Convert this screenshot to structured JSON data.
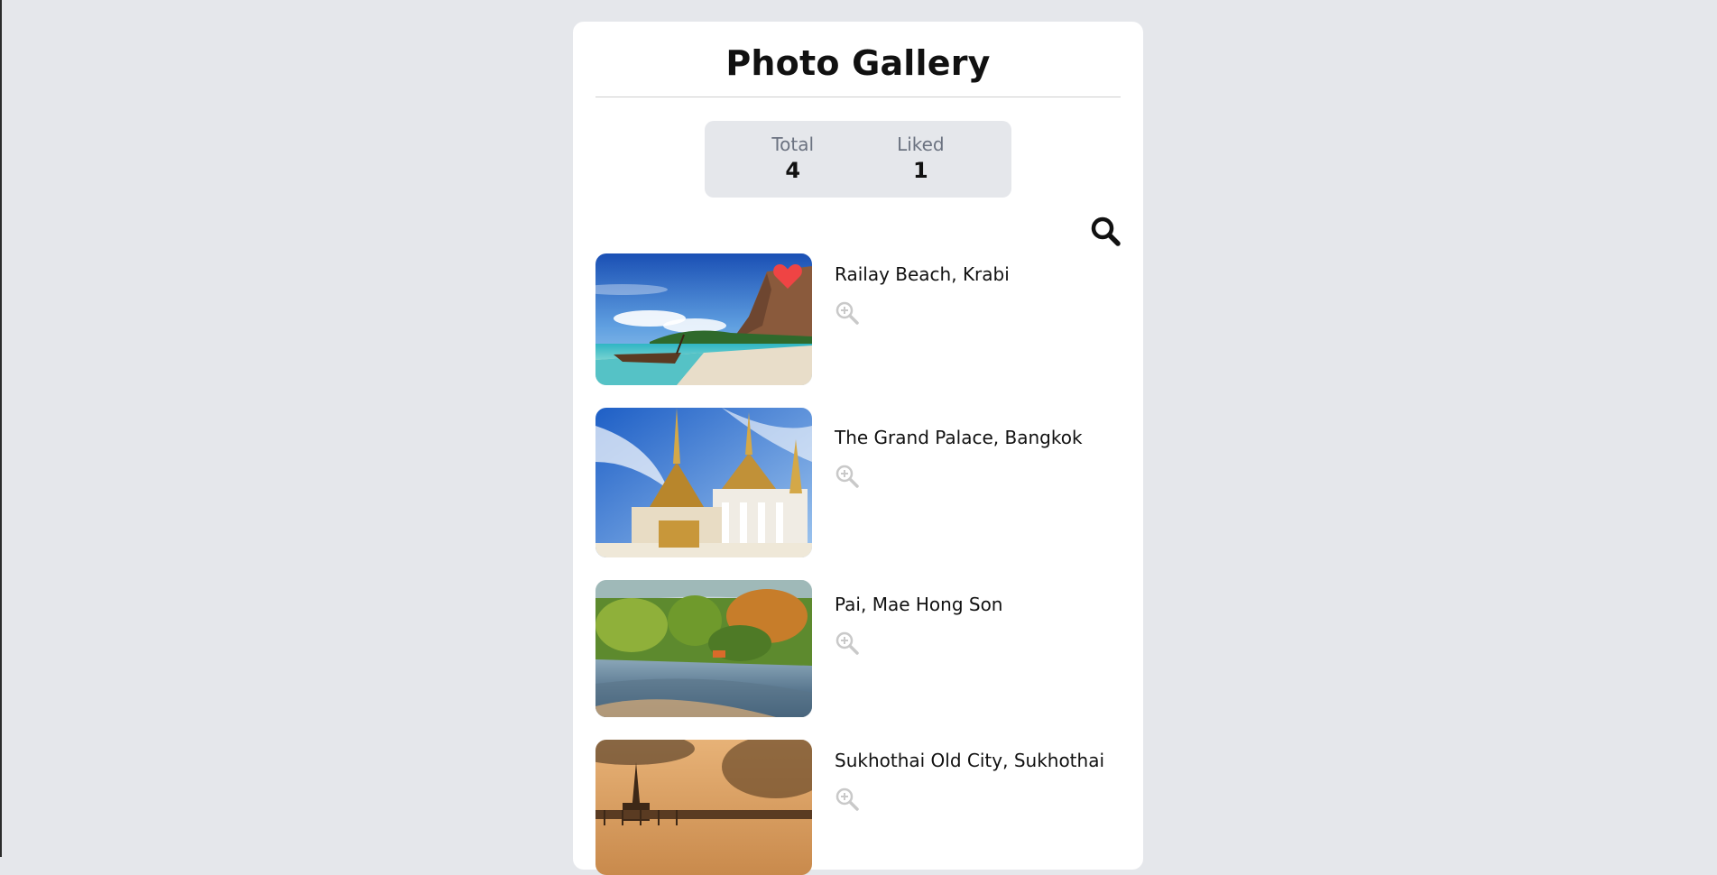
{
  "gallery": {
    "title": "Photo Gallery",
    "stats": {
      "total_label": "Total",
      "total_value": "4",
      "liked_label": "Liked",
      "liked_value": "1"
    },
    "search_icon": "search-icon",
    "photos": [
      {
        "name": "Railay Beach, Krabi",
        "liked": true,
        "icon": "zoom-in-icon"
      },
      {
        "name": "The Grand Palace, Bangkok",
        "liked": false,
        "icon": "zoom-in-icon"
      },
      {
        "name": "Pai, Mae Hong Son",
        "liked": false,
        "icon": "zoom-in-icon"
      },
      {
        "name": "Sukhothai Old City, Sukhothai",
        "liked": false,
        "icon": "zoom-in-icon"
      }
    ]
  },
  "colors": {
    "page_bg": "#e5e7eb",
    "card_bg": "#ffffff",
    "heart": "#ef4444",
    "muted_text": "#6b7280"
  }
}
